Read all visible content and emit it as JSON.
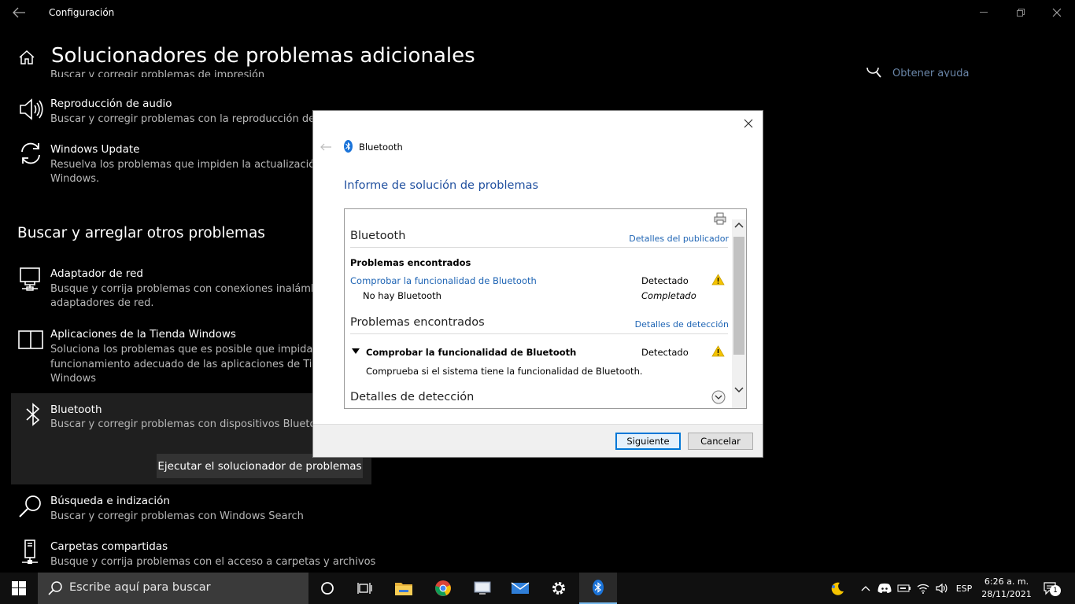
{
  "window": {
    "title": "Configuración"
  },
  "header": {
    "title": "Solucionadores de problemas adicionales"
  },
  "partial_top_row": {
    "desc": "Buscar y corregir problemas de impresión"
  },
  "help_link": "Obtener ayuda",
  "top_items": [
    {
      "title": "Reproducción de audio",
      "desc": "Buscar y corregir problemas con la reproducción de so",
      "icon": "speaker-icon"
    },
    {
      "title": "Windows Update",
      "desc1": "Resuelva los problemas que impiden la actualización d",
      "desc2": "Windows.",
      "icon": "refresh-icon"
    }
  ],
  "section2": {
    "heading": "Buscar y arreglar otros problemas",
    "items": [
      {
        "title": "Adaptador de red",
        "desc1": "Busque y corrija problemas con conexiones inalámbric",
        "desc2": "adaptadores de red.",
        "icon": "network-icon"
      },
      {
        "title": "Aplicaciones de la Tienda Windows",
        "desc1": "Soluciona los problemas que es posible que impidan e",
        "desc2": "funcionamiento adecuado de las aplicaciones de Tiend",
        "desc3": "Windows",
        "icon": "store-apps-icon"
      },
      {
        "title": "Bluetooth",
        "desc": "Buscar y corregir problemas con dispositivos Bluetooth",
        "button": "Ejecutar el solucionador de problemas",
        "icon": "bluetooth-icon"
      },
      {
        "title": "Búsqueda e indización",
        "desc": "Buscar y corregir problemas con Windows Search",
        "icon": "search-magnifier-icon"
      },
      {
        "title": "Carpetas compartidas",
        "desc": "Busque y corrija problemas con el acceso a carpetas y archivos",
        "icon": "shared-folder-icon"
      }
    ]
  },
  "dialog": {
    "app_title": "Bluetooth",
    "heading": "Informe de solución de problemas",
    "report": {
      "section1_title": "Bluetooth",
      "publisher_link": "Detalles del publicador",
      "problems_found_bold": "Problemas encontrados",
      "check_link": "Comprobar la funcionalidad de Bluetooth",
      "status_detected": "Detectado",
      "no_bluetooth": "No hay Bluetooth",
      "status_completed": "Completado",
      "section2_title": "Problemas encontrados",
      "detection_details_link": "Detalles de detección",
      "check_bold": "Comprobar la funcionalidad de Bluetooth",
      "status_detected2": "Detectado",
      "check_desc": "Comprueba si el sistema tiene la funcionalidad de Bluetooth.",
      "section3_title": "Detalles de detección"
    },
    "next_button": "Siguiente",
    "cancel_button": "Cancelar"
  },
  "taskbar": {
    "search_placeholder": "Escribe aquí para buscar",
    "language": "ESP",
    "time": "6:26 a. m.",
    "date": "28/11/2021",
    "notification_count": "1"
  },
  "colors": {
    "accent": "#0078d7",
    "link": "#1e64b4",
    "dialog_heading": "#1e4e9e",
    "warning": "#f5c400"
  }
}
